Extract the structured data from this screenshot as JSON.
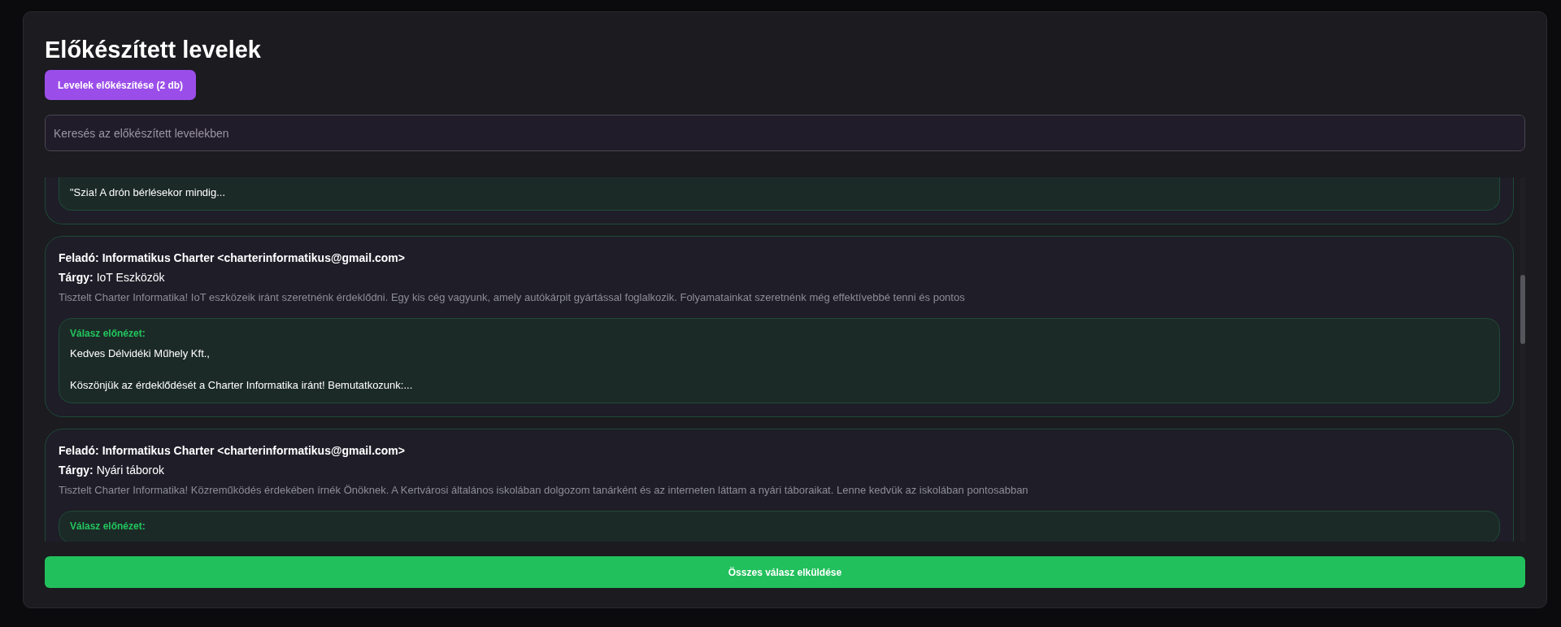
{
  "title": "Előkészített levelek",
  "prepare_button": "Levelek előkészítése (2 db)",
  "search": {
    "placeholder": "Keresés az előkészített levelekben"
  },
  "emails": [
    {
      "reply_preview": {
        "lines": [
          "\"Szia! A drón bérlésekor mindig..."
        ]
      }
    },
    {
      "sender_label": "Feladó:",
      "sender": "Informatikus Charter <charterinformatikus@gmail.com>",
      "subject_label": "Tárgy:",
      "subject": "IoT Eszközök",
      "body": "Tisztelt Charter Informatika! IoT eszközeik iránt szeretnénk érdeklődni. Egy kis cég vagyunk, amely autókárpit gyártással foglalkozik. Folyamatainkat szeretnénk még effektívebbé tenni és pontos",
      "reply_preview": {
        "label": "Válasz előnézet:",
        "lines": [
          "Kedves Délvidéki Műhely Kft.,",
          "Köszönjük az érdeklődését a Charter Informatika iránt! Bemutatkozunk:..."
        ]
      }
    },
    {
      "sender_label": "Feladó:",
      "sender": "Informatikus Charter <charterinformatikus@gmail.com>",
      "subject_label": "Tárgy:",
      "subject": "Nyári táborok",
      "body": "Tisztelt Charter Informatika! Közreműködés érdekében írnék Önöknek. A Kertvárosi általános iskolában dolgozom tanárként és az interneten láttam a nyári táboraikat. Lenne kedvük az iskolában pontosabban",
      "reply_preview": {
        "label": "Válasz előnézet:"
      }
    }
  ],
  "send_all_button": "Összes válasz elküldése"
}
